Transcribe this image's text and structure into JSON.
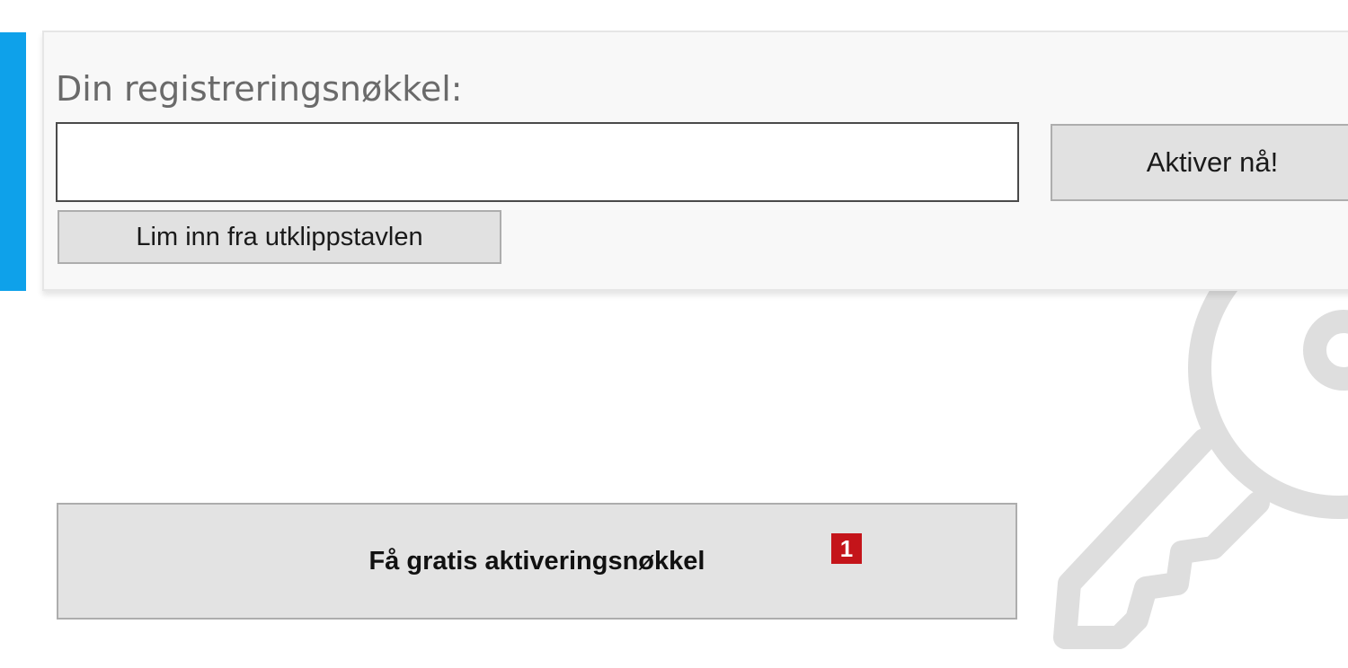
{
  "window": {
    "accent_color": "#0ea1ea"
  },
  "registration": {
    "title": "Din registreringsnøkkel:",
    "key_input_value": "",
    "key_input_placeholder": "",
    "activate_label": "Aktiver nå!",
    "paste_label": "Lim inn fra utklippstavlen"
  },
  "free_key": {
    "button_label": "Få gratis aktiveringsnøkkel",
    "badge_count": "1",
    "badge_color": "#c4141a"
  },
  "decor": {
    "watermark_icon": "key-icon"
  }
}
